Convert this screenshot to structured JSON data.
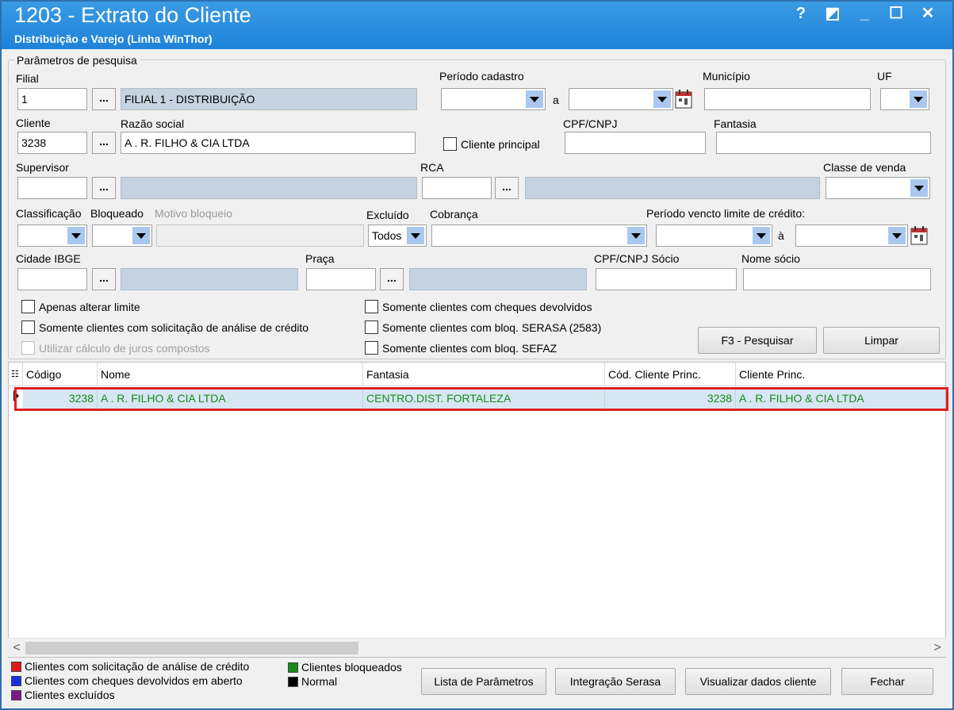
{
  "window": {
    "title": "1203 - Extrato do Cliente",
    "subtitle": "Distribuição e Varejo (Linha WinThor)",
    "controls": [
      "?",
      "◩",
      "_",
      "☐",
      "✕"
    ]
  },
  "params": {
    "group_title": "Parâmetros de pesquisa",
    "filial": {
      "label": "Filial",
      "value": "1",
      "name": "FILIAL 1 - DISTRIBUIÇÃO"
    },
    "periodo_cadastro": {
      "label": "Período cadastro",
      "sep": "a"
    },
    "municipio": {
      "label": "Município"
    },
    "uf": {
      "label": "UF"
    },
    "cliente": {
      "label": "Cliente",
      "value": "3238"
    },
    "razao_social": {
      "label": "Razão social",
      "value": "A . R.  FILHO & CIA LTDA"
    },
    "cliente_principal": {
      "label": "Cliente principal"
    },
    "cpf_cnpj": {
      "label": "CPF/CNPJ"
    },
    "fantasia": {
      "label": "Fantasia"
    },
    "supervisor": {
      "label": "Supervisor"
    },
    "rca": {
      "label": "RCA"
    },
    "classe_venda": {
      "label": "Classe de venda"
    },
    "classificacao": {
      "label": "Classificação"
    },
    "bloqueado": {
      "label": "Bloqueado"
    },
    "motivo_bloqueio": {
      "label": "Motivo bloqueio"
    },
    "excluido": {
      "label": "Excluído",
      "value": "Todos"
    },
    "cobranca": {
      "label": "Cobrança"
    },
    "periodo_vencto": {
      "label": "Período vencto limite de crédito:",
      "sep": "à"
    },
    "cidade_ibge": {
      "label": "Cidade IBGE"
    },
    "praca": {
      "label": "Praça"
    },
    "cpf_cnpj_socio": {
      "label": "CPF/CNPJ Sócio"
    },
    "nome_socio": {
      "label": "Nome sócio"
    },
    "dots": "..."
  },
  "checks": {
    "apenas_limite": "Apenas alterar limite",
    "solicitacao": "Somente clientes com solicitação de análise de crédito",
    "juros": "Utilizar cálculo de juros compostos",
    "cheques": "Somente clientes com cheques devolvidos",
    "serasa": "Somente clientes com bloq. SERASA (2583)",
    "sefaz": "Somente clientes com bloq. SEFAZ"
  },
  "buttons": {
    "pesquisar": "F3 - Pesquisar",
    "limpar": "Limpar",
    "lista": "Lista de Parâmetros",
    "serasa": "Integração Serasa",
    "visualizar": "Visualizar dados cliente",
    "fechar": "Fechar"
  },
  "grid": {
    "headers": [
      "Código",
      "Nome",
      "Fantasia",
      "Cód. Cliente Princ.",
      "Cliente Princ."
    ],
    "rows": [
      {
        "codigo": "3238",
        "nome": "A . R.  FILHO & CIA LTDA",
        "fantasia": "CENTRO.DIST. FORTALEZA",
        "cod_princ": "3238",
        "cliente_princ": "A . R.  FILHO & CIA LTDA"
      }
    ],
    "scroll_left": "<",
    "scroll_right": ">"
  },
  "legend": [
    {
      "label": "Clientes com solicitação de análise de crédito",
      "color": "#e01818"
    },
    {
      "label": "Clientes com cheques devolvidos em aberto",
      "color": "#1a2ee0"
    },
    {
      "label": "Clientes excluídos",
      "color": "#7a1a8a"
    },
    {
      "label": "Clientes bloqueados",
      "color": "#1a8a1a"
    },
    {
      "label": "Normal",
      "color": "#000000"
    }
  ]
}
